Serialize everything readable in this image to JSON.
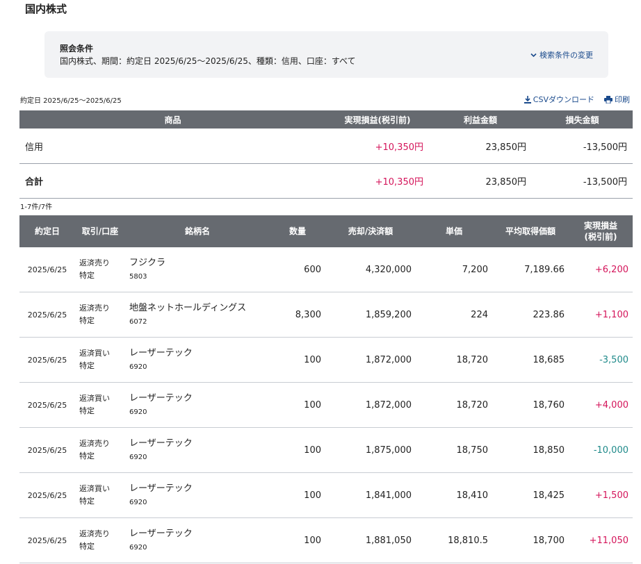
{
  "page_title": "国内株式",
  "condition": {
    "heading": "照会条件",
    "text": "国内株式、期間：約定日 2025/6/25〜2025/6/25、種類：信用、口座：すべて",
    "change_label": "検索条件の変更"
  },
  "period_label": "約定日 2025/6/25〜2025/6/25",
  "toolbar": {
    "csv_label": "CSVダウンロード",
    "print_label": "印刷"
  },
  "summary": {
    "headers": {
      "product": "商品",
      "realized": "実現損益(税引前)",
      "profit": "利益金額",
      "loss": "損失金額"
    },
    "rows": [
      {
        "product": "信用",
        "realized": "+10,350円",
        "profit": "23,850円",
        "loss": "-13,500円"
      },
      {
        "product": "合計",
        "realized": "+10,350円",
        "profit": "23,850円",
        "loss": "-13,500円"
      }
    ]
  },
  "count_label": "1-7件/7件",
  "detail": {
    "headers": {
      "date": "約定日",
      "trade": "取引/口座",
      "name": "銘柄名",
      "qty": "数量",
      "amount": "売却/決済額",
      "price": "単価",
      "avg": "平均取得価額",
      "pl_line1": "実現損益",
      "pl_line2": "(税引前)"
    },
    "rows": [
      {
        "date": "2025/6/25",
        "trade": "返済売り",
        "account": "特定",
        "name": "フジクラ",
        "code": "5803",
        "qty": "600",
        "amount": "4,320,000",
        "price": "7,200",
        "avg": "7,189.66",
        "pl": "+6,200"
      },
      {
        "date": "2025/6/25",
        "trade": "返済売り",
        "account": "特定",
        "name": "地盤ネットホールディングス",
        "code": "6072",
        "qty": "8,300",
        "amount": "1,859,200",
        "price": "224",
        "avg": "223.86",
        "pl": "+1,100"
      },
      {
        "date": "2025/6/25",
        "trade": "返済買い",
        "account": "特定",
        "name": "レーザーテック",
        "code": "6920",
        "qty": "100",
        "amount": "1,872,000",
        "price": "18,720",
        "avg": "18,685",
        "pl": "-3,500"
      },
      {
        "date": "2025/6/25",
        "trade": "返済買い",
        "account": "特定",
        "name": "レーザーテック",
        "code": "6920",
        "qty": "100",
        "amount": "1,872,000",
        "price": "18,720",
        "avg": "18,760",
        "pl": "+4,000"
      },
      {
        "date": "2025/6/25",
        "trade": "返済売り",
        "account": "特定",
        "name": "レーザーテック",
        "code": "6920",
        "qty": "100",
        "amount": "1,875,000",
        "price": "18,750",
        "avg": "18,850",
        "pl": "-10,000"
      },
      {
        "date": "2025/6/25",
        "trade": "返済買い",
        "account": "特定",
        "name": "レーザーテック",
        "code": "6920",
        "qty": "100",
        "amount": "1,841,000",
        "price": "18,410",
        "avg": "18,425",
        "pl": "+1,500"
      },
      {
        "date": "2025/6/25",
        "trade": "返済売り",
        "account": "特定",
        "name": "レーザーテック",
        "code": "6920",
        "qty": "100",
        "amount": "1,881,050",
        "price": "18,810.5",
        "avg": "18,700",
        "pl": "+11,050"
      }
    ]
  },
  "colors": {
    "header_bg": "#666a70",
    "positive": "#d4145a",
    "negative": "#1f8a8a",
    "link": "#1a4a8c",
    "condition_bg": "#f2f3f5"
  },
  "icons": {
    "change": "chevron-down-icon",
    "csv": "download-icon",
    "print": "printer-icon"
  }
}
